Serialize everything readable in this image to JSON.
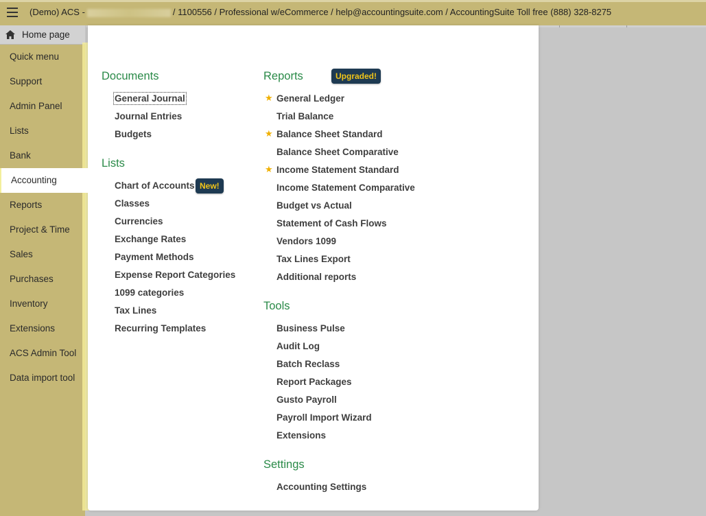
{
  "topbar": {
    "title_prefix": "(Demo) ACS -",
    "title_suffix": "/ 1100556 / Professional w/eCommerce / help@accountingsuite.com / AccountingSuite Toll free (888) 328-8275"
  },
  "sidebar": {
    "home_label": "Home page",
    "items": [
      {
        "label": "Quick menu"
      },
      {
        "label": "Support"
      },
      {
        "label": "Admin Panel"
      },
      {
        "label": "Lists"
      },
      {
        "label": "Bank"
      },
      {
        "label": "Accounting"
      },
      {
        "label": "Reports"
      },
      {
        "label": "Project & Time"
      },
      {
        "label": "Sales"
      },
      {
        "label": "Purchases"
      },
      {
        "label": "Inventory"
      },
      {
        "label": "Extensions"
      },
      {
        "label": "ACS Admin Tool"
      },
      {
        "label": "Data import tool"
      }
    ],
    "active": "Accounting"
  },
  "colors": {
    "sidebar_bg": "#c5b776",
    "section_title": "#2a8a48",
    "badge_bg": "#1e3a52",
    "badge_text": "#f0c419",
    "star": "#f0b000"
  },
  "menu": {
    "documents": {
      "title": "Documents",
      "items": [
        "General Journal",
        "Journal Entries",
        "Budgets"
      ]
    },
    "lists": {
      "title": "Lists",
      "new_badge": "New!",
      "items": [
        "Chart of Accounts",
        "Classes",
        "Currencies",
        "Exchange Rates",
        "Payment Methods",
        "Expense Report Categories",
        "1099 categories",
        "Tax Lines",
        "Recurring Templates"
      ]
    },
    "reports": {
      "title": "Reports",
      "upgraded_badge": "Upgraded!",
      "items": [
        "General Ledger",
        "Trial Balance",
        "Balance Sheet Standard",
        "Balance Sheet Comparative",
        "Income Statement Standard",
        "Income Statement Comparative",
        "Budget vs Actual",
        "Statement of Cash Flows",
        "Vendors 1099",
        "Tax Lines Export",
        "Additional reports"
      ],
      "starred": [
        "General Ledger",
        "Balance Sheet Standard",
        "Income Statement Standard"
      ],
      "star_icon": "star-icon"
    },
    "tools": {
      "title": "Tools",
      "items": [
        "Business Pulse",
        "Audit Log",
        "Batch Reclass",
        "Report Packages",
        "Gusto Payroll",
        "Payroll Import Wizard",
        "Extensions"
      ]
    },
    "settings": {
      "title": "Settings",
      "items": [
        "Accounting Settings"
      ]
    }
  }
}
